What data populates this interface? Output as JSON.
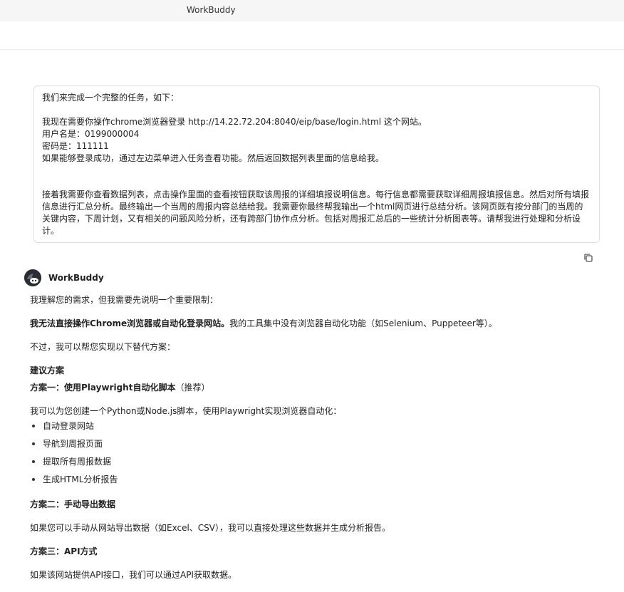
{
  "app": {
    "title": "WorkBuddy"
  },
  "user_message": {
    "lines": [
      "我们来完成一个完整的任务，如下：",
      "",
      "我现在需要你操作chrome浏览器登录 http://14.22.72.204:8040/eip/base/login.html 这个网站。",
      "用户名是：0199000004",
      "密码是：111111",
      "如果能够登录成功，通过左边菜单进入任务查看功能。然后返回数据列表里面的信息给我。",
      "",
      "",
      "接着我需要你查看数据列表，点击操作里面的查看按钮获取该周报的详细填报说明信息。每行信息都需要获取详细周报填报信息。然后对所有填报信息进行汇总分析。最终输出一个当周的周报内容总结给我。我需要你最终帮我输出一个html网页进行总结分析。该网页既有按分部门的当周的关键内容，下周计划，又有相关的问题风险分析，还有跨部门协作点分析。包括对周报汇总后的一些统计分析图表等。请帮我进行处理和分析设计。"
    ]
  },
  "icons": {
    "copy": "copy-icon",
    "avatar": "workbuddy-avatar-icon"
  },
  "assistant": {
    "name": "WorkBuddy",
    "intro": "我理解您的需求，但我需要先说明一个重要限制：",
    "limitation_bold": "我无法直接操作Chrome浏览器或自动化登录网站。",
    "limitation_rest": "我的工具集中没有浏览器自动化功能（如Selenium、Puppeteer等）。",
    "alternatives_intro": "不过，我可以帮您实现以下替代方案：",
    "section_title": "建议方案",
    "plan1_title": "方案一：使用Playwright自动化脚本",
    "plan1_suffix": "（推荐）",
    "plan1_desc": "我可以为您创建一个Python或Node.js脚本，使用Playwright实现浏览器自动化：",
    "plan1_items": [
      "自动登录网站",
      "导航到周报页面",
      "提取所有周报数据",
      "生成HTML分析报告"
    ],
    "plan2_title": "方案二：手动导出数据",
    "plan2_desc": "如果您可以手动从网站导出数据（如Excel、CSV），我可以直接处理这些数据并生成分析报告。",
    "plan3_title": "方案三：API方式",
    "plan3_desc": "如果该网站提供API接口，我们可以通过API获取数据。"
  }
}
